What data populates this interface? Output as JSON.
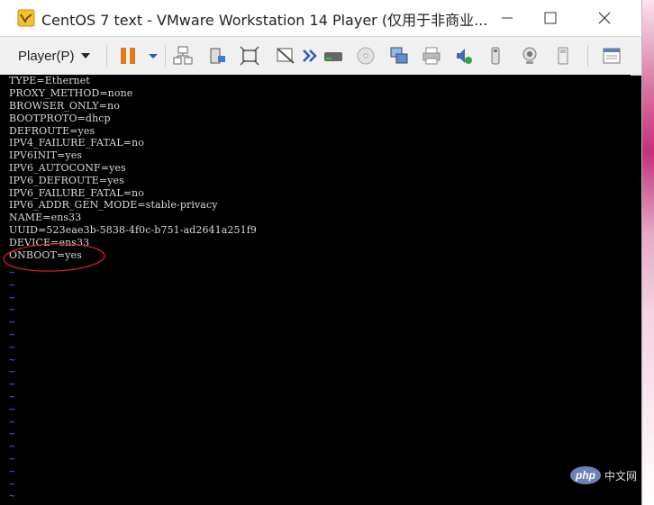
{
  "window": {
    "title": "CentOS 7 text - VMware Workstation 14 Player (仅用于非商业..."
  },
  "toolbar": {
    "player_menu_label": "Player(P)",
    "icons": [
      "pause-icon",
      "dropdown-arrow-icon",
      "network-send-ctrl-alt-del-icon",
      "removable-devices-icon",
      "fullscreen-icon",
      "unity-icon",
      "forward-arrows-icon",
      "hard-disk-icon",
      "cd-drive-icon",
      "network-adapter-icon",
      "printer-icon",
      "sound-icon",
      "usb-icon",
      "camera-icon",
      "usb-stick-icon",
      "message-log-icon"
    ]
  },
  "terminal": {
    "lines": [
      "TYPE=Ethernet",
      "PROXY_METHOD=none",
      "BROWSER_ONLY=no",
      "BOOTPROTO=dhcp",
      "DEFROUTE=yes",
      "IPV4_FAILURE_FATAL=no",
      "IPV6INIT=yes",
      "IPV6_AUTOCONF=yes",
      "IPV6_DEFROUTE=yes",
      "IPV6_FAILURE_FATAL=no",
      "IPV6_ADDR_GEN_MODE=stable-privacy",
      "NAME=ens33",
      "UUID=523eae3b-5838-4f0c-b751-ad2641a251f9",
      "DEVICE=ens33",
      "ONBOOT=yes"
    ],
    "tilde": "~",
    "tilde_count": 19,
    "highlighted_line": "ONBOOT=yes"
  },
  "watermark": {
    "logo": "php",
    "text": "中文网"
  },
  "colors": {
    "annotation_circle": "#c8202a",
    "tilde": "#4a68ff",
    "terminal_text": "#d9d9d9"
  }
}
